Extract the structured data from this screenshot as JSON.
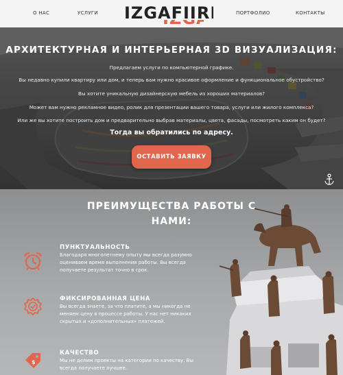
{
  "nav": {
    "about": "О НАС",
    "services": "УСЛУГИ",
    "portfolio": "ПОРТФОЛИО",
    "contacts": "КОНТАКТЫ"
  },
  "logo": {
    "main": "IZGAFIIRI",
    "accent": "IZGAFIIRI"
  },
  "hero": {
    "title": "АРХИТЕКТУРНАЯ И ИНТЕРЬЕРНАЯ 3D ВИЗУАЛИЗАЦИЯ:",
    "lines": [
      "Предлагаем услуги по компьютерной графике.",
      "Вы недавно купили квартиру или дом, и теперь вам нужно красивое оформление и функциональное обустройство?",
      "Вы хотите уникальную дизайнерскую мебель из хороших материалов?",
      "Может вам нужно рекламное видео, ролик для презентации вашего товара, услуги или жилого комплекса?",
      "Или же вы хотите построить дом и предварительно выбрав материалы, цвета, фасады, посмотреть каким он будет?"
    ],
    "strong": "Тогда вы обратились по адресу.",
    "cta": "ОСТАВИТЬ ЗАЯВКУ"
  },
  "advantages": {
    "title": "ПРЕИМУЩЕСТВА РАБОТЫ С НАМИ:",
    "items": [
      {
        "icon": "alarm-clock-icon",
        "title": "ПУНКТУАЛЬНОСТЬ",
        "text": "Благодаря многолетнему опыту мы всегда разумно оцениваем время выполнения работы. Вы всегда получаете результат точно в срок."
      },
      {
        "icon": "badge-check-icon",
        "title": "ФИКСИРОВАННАЯ ЦЕНА",
        "text": "Вы всегда знаете, за что платите, а мы никогда не меняем цену в процессе работы. У нас нет никаких скрытых и «дополнительных» платежей."
      },
      {
        "icon": "price-tag-icon",
        "title": "КАЧЕСТВО",
        "text": "Мы не делим проекты на категории по качеству. Вы всегда получаете лучшее."
      }
    ]
  },
  "colors": {
    "accent": "#e2664d",
    "header_bg": "#f4f4f4"
  }
}
